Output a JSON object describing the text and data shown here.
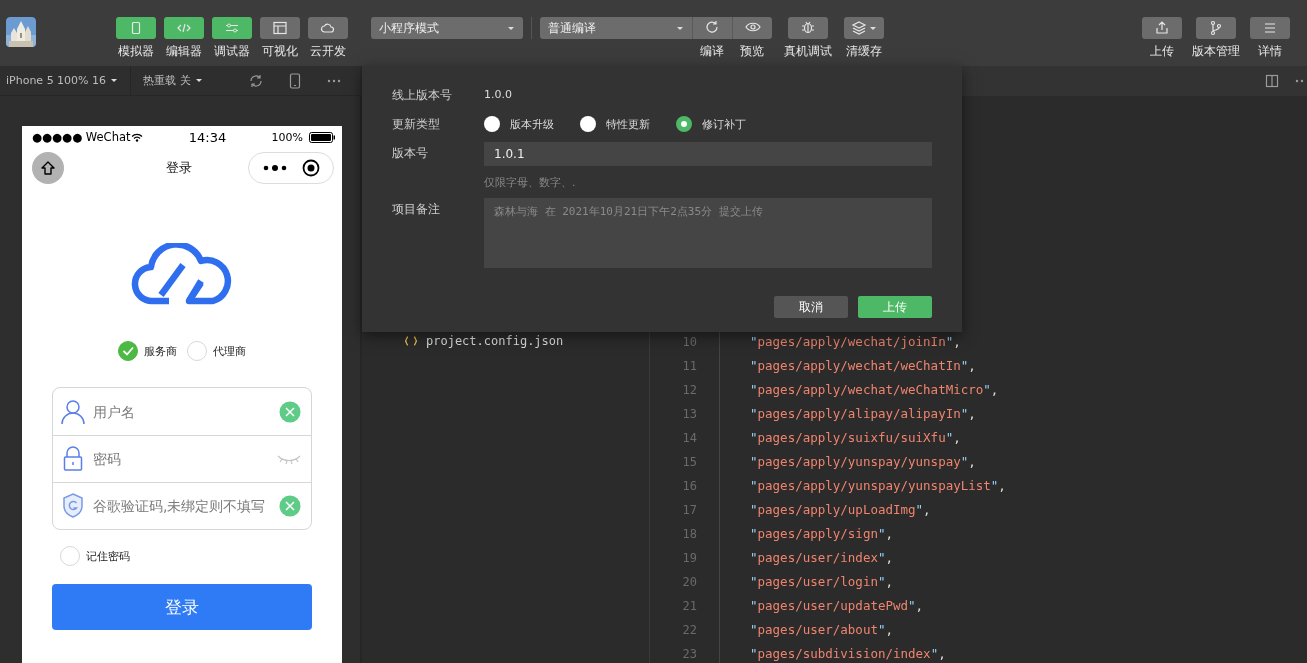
{
  "toolbar": {
    "tools": [
      {
        "label": "模拟器",
        "on": true
      },
      {
        "label": "编辑器",
        "on": true
      },
      {
        "label": "调试器",
        "on": true
      },
      {
        "label": "可视化",
        "on": false
      },
      {
        "label": "云开发",
        "on": false
      }
    ],
    "mode_select": "小程序模式",
    "compile_select": "普通编译",
    "actions": [
      {
        "label": "编译"
      },
      {
        "label": "预览"
      },
      {
        "label": "真机调试"
      },
      {
        "label": "清缓存"
      }
    ],
    "right_actions": [
      {
        "label": "上传"
      },
      {
        "label": "版本管理"
      },
      {
        "label": "详情"
      }
    ]
  },
  "simulator_bar": {
    "device": "iPhone 5 100% 16",
    "hot_reload": "热重载 关"
  },
  "phone": {
    "carrier": "●●●●● WeChat",
    "time": "14:34",
    "battery": "100%",
    "title": "登录",
    "user_types": [
      {
        "label": "服务商",
        "selected": true
      },
      {
        "label": "代理商",
        "selected": false
      }
    ],
    "fields": [
      {
        "placeholder": "用户名",
        "kind": "text"
      },
      {
        "placeholder": "密码",
        "kind": "password"
      },
      {
        "placeholder": "谷歌验证码,未绑定则不填写",
        "kind": "text"
      }
    ],
    "remember": {
      "label": "记住密码",
      "checked": false
    },
    "submit": "登录"
  },
  "file_tree": {
    "items": [
      "project.config.json"
    ]
  },
  "code": {
    "lines": [
      {
        "number": "10",
        "text": "\"pages/apply/wechat/joinIn\","
      },
      {
        "number": "11",
        "text": "\"pages/apply/wechat/weChatIn\","
      },
      {
        "number": "12",
        "text": "\"pages/apply/wechat/weChatMicro\","
      },
      {
        "number": "13",
        "text": "\"pages/apply/alipay/alipayIn\","
      },
      {
        "number": "14",
        "text": "\"pages/apply/suixfu/suiXfu\","
      },
      {
        "number": "15",
        "text": "\"pages/apply/yunspay/yunspay\","
      },
      {
        "number": "16",
        "text": "\"pages/apply/yunspay/yunspayList\","
      },
      {
        "number": "17",
        "text": "\"pages/apply/upLoadImg\","
      },
      {
        "number": "18",
        "text": "\"pages/apply/sign\","
      },
      {
        "number": "19",
        "text": "\"pages/user/index\","
      },
      {
        "number": "20",
        "text": "\"pages/user/login\","
      },
      {
        "number": "21",
        "text": "\"pages/user/updatePwd\","
      },
      {
        "number": "22",
        "text": "\"pages/user/about\","
      },
      {
        "number": "23",
        "text": "\"pages/subdivision/index\","
      }
    ]
  },
  "upload_dialog": {
    "online_version_label": "线上版本号",
    "online_version": "1.0.0",
    "update_type_label": "更新类型",
    "update_types": [
      {
        "label": "版本升级",
        "selected": false
      },
      {
        "label": "特性更新",
        "selected": false
      },
      {
        "label": "修订补丁",
        "selected": true
      }
    ],
    "version_label": "版本号",
    "version": "1.0.1",
    "version_hint": "仅限字母、数字、.",
    "notes_label": "项目备注",
    "notes_placeholder": "森林与海 在 2021年10月21日下午2点35分 提交上传",
    "buttons": [
      {
        "label": "取消",
        "kind": "secondary"
      },
      {
        "label": "上传",
        "kind": "primary"
      }
    ]
  }
}
